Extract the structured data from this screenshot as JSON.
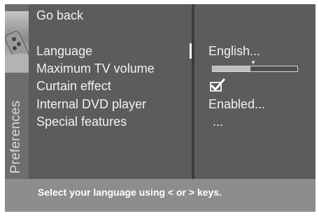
{
  "sidebar": {
    "label": "Preferences",
    "thumbnail_icon": "remote-control-icon"
  },
  "menu": {
    "go_back": "Go back",
    "items": [
      {
        "label": "Language",
        "value": "English..."
      },
      {
        "label": "Maximum TV volume",
        "value_fraction": 0.45
      },
      {
        "label": "Curtain effect",
        "checked": true
      },
      {
        "label": "Internal DVD player",
        "value": "Enabled..."
      },
      {
        "label": "Special features",
        "value": "..."
      }
    ]
  },
  "status": {
    "text": "Select your language using < or > keys."
  },
  "colors": {
    "screen_bg": "#5b5b5b",
    "status_bg": "#8d8d8d",
    "text": "#f2f2f2",
    "divider": "#3c3c3c"
  }
}
